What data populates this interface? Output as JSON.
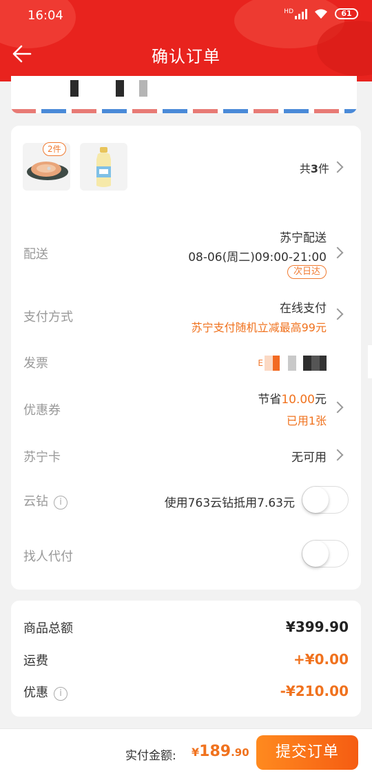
{
  "status_bar": {
    "time": "16:04",
    "network": "HD",
    "battery": "61"
  },
  "header": {
    "title": "确认订单"
  },
  "order": {
    "badge": "2件",
    "count_prefix": "共",
    "count_num": "3",
    "count_suffix": "件",
    "delivery": {
      "label": "配送",
      "carrier": "苏宁配送",
      "time": "08-06(周二)09:00-21:00",
      "tag": "次日达"
    },
    "payment": {
      "label": "支付方式",
      "method": "在线支付",
      "promo": "苏宁支付随机立减最高99元"
    },
    "invoice": {
      "label": "发票",
      "text": "E"
    },
    "coupon": {
      "label": "优惠券",
      "save_prefix": "节省",
      "save_amount": "10.00",
      "save_suffix": "元",
      "used": "已用1张"
    },
    "card": {
      "label": "苏宁卡",
      "value": "无可用"
    },
    "cloud_diamond": {
      "label": "云钻",
      "value": "使用763云钻抵用7.63元",
      "enabled": false
    },
    "proxy_pay": {
      "label": "找人代付",
      "enabled": false
    }
  },
  "summary": {
    "goods_label": "商品总额",
    "goods_value": "¥399.90",
    "shipping_label": "运费",
    "shipping_value": "+¥0.00",
    "discount_label": "优惠",
    "discount_value": "-¥210.00"
  },
  "bottom": {
    "pay_label": "实付金额:",
    "currency": "¥",
    "amount_int": "189",
    "amount_dec": ".90",
    "submit": "提交订单"
  },
  "colors": {
    "brand_red": "#e8231e",
    "accent_orange": "#f0721e"
  }
}
